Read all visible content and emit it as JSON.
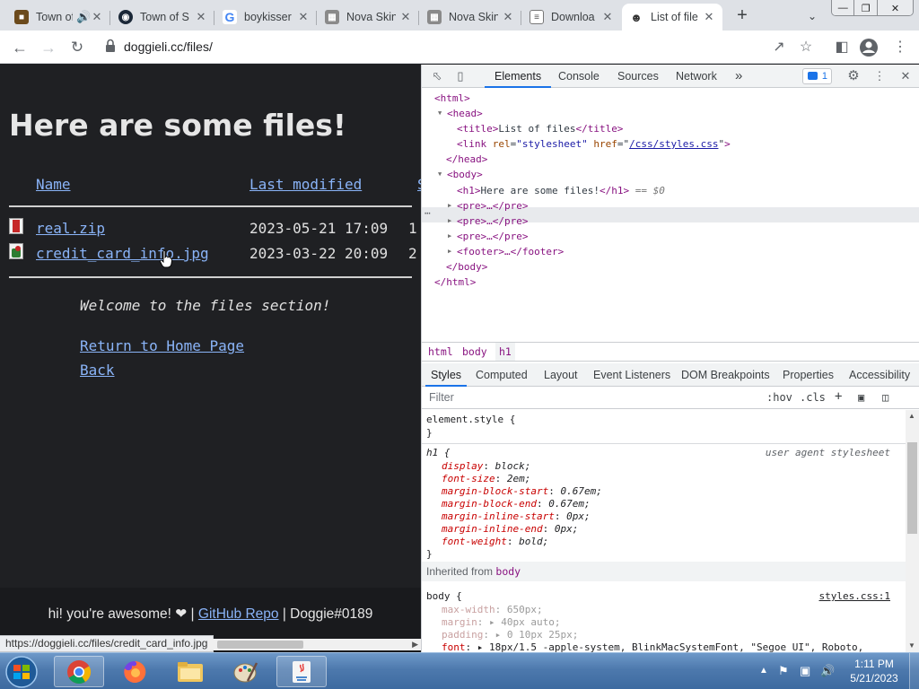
{
  "browser": {
    "tabs": [
      {
        "title": "Town of",
        "favicon": "game-icon"
      },
      {
        "title": "Town of S",
        "favicon": "steam-icon"
      },
      {
        "title": "boykisser",
        "favicon": "google-icon"
      },
      {
        "title": "Nova Skin",
        "favicon": "minecraft-icon"
      },
      {
        "title": "Nova Skin",
        "favicon": "minecraft-icon"
      },
      {
        "title": "Downloa",
        "favicon": "document-icon"
      },
      {
        "title": "List of file",
        "favicon": "dog-icon"
      }
    ],
    "url": "doggieli.cc/files/",
    "status_url": "https://doggieli.cc/files/credit_card_info.jpg"
  },
  "page": {
    "heading": "Here are some files!",
    "columns": {
      "name": "Name",
      "modified": "Last modified",
      "size": "S"
    },
    "files": [
      {
        "name": "real.zip",
        "modified": "2023-05-21 17:09",
        "size": "1"
      },
      {
        "name": "credit_card_info.jpg",
        "modified": "2023-03-22 20:09",
        "size": "2"
      }
    ],
    "welcome": "Welcome to the files section!",
    "links": {
      "home": "Return to Home Page",
      "back": "Back"
    },
    "footer": {
      "prefix": "hi! you're awesome! ❤ |",
      "repo": "GitHub Repo",
      "suffix": "| Doggie#0189"
    }
  },
  "devtools": {
    "tabs": [
      "Elements",
      "Console",
      "Sources",
      "Network",
      "»"
    ],
    "issues_count": "1",
    "dom": {
      "html_open": "<html>",
      "head_open": "<head>",
      "title_open": "<title>",
      "title_text": "List of files",
      "title_close": "</title>",
      "link_open": "<link ",
      "link_rel_attr": "rel",
      "link_rel_val": "\"stylesheet\"",
      "link_href_attr": " href",
      "link_href_val": "/css/styles.css",
      "link_close": ">",
      "head_close": "</head>",
      "body_open": "<body>",
      "h1_open": "<h1>",
      "h1_text": "Here are some files!",
      "h1_close": "</h1>",
      "h1_eq": "== $0",
      "pre1": "<pre>…</pre>",
      "pre2": "<pre>…</pre>",
      "pre3": "<pre>…</pre>",
      "footer": "<footer>…</footer>",
      "body_close": "</body>",
      "html_close": "</html>"
    },
    "breadcrumbs": [
      "html",
      "body",
      "h1"
    ],
    "style_tabs": [
      "Styles",
      "Computed",
      "Layout",
      "Event Listeners",
      "DOM Breakpoints",
      "Properties",
      "Accessibility"
    ],
    "filter_placeholder": "Filter",
    "filter_hov": ":hov",
    "filter_cls": ".cls",
    "element_style": "element.style {",
    "close_brace": "}",
    "h1_rule": {
      "selector": "h1 {",
      "source": "user agent stylesheet",
      "props": [
        {
          "p": "display",
          "v": "block;"
        },
        {
          "p": "font-size",
          "v": "2em;"
        },
        {
          "p": "margin-block-start",
          "v": "0.67em;"
        },
        {
          "p": "margin-block-end",
          "v": "0.67em;"
        },
        {
          "p": "margin-inline-start",
          "v": "0px;"
        },
        {
          "p": "margin-inline-end",
          "v": "0px;"
        },
        {
          "p": "font-weight",
          "v": "bold;"
        }
      ]
    },
    "inherited_label": "Inherited from",
    "inherited_from": "body",
    "body_rule": {
      "selector": "body {",
      "source": "styles.css:1",
      "props": [
        {
          "p": "max-width",
          "v": "650px;"
        },
        {
          "p": "margin",
          "v": "40px auto;"
        },
        {
          "p": "padding",
          "v": "0 10px 25px;"
        },
        {
          "p": "font",
          "v": "18px/1.5 -apple-system, BlinkMacSystemFont, \"Segoe UI\", Roboto,"
        }
      ]
    }
  },
  "taskbar": {
    "time": "1:11 PM",
    "date": "5/21/2023",
    "apps": [
      "chrome-icon",
      "firefox-icon",
      "explorer-icon",
      "paint-icon",
      "java-icon"
    ]
  },
  "colors": {
    "link": "#8ab4f8",
    "page_bg": "#1f2023",
    "accent": "#1a73e8"
  }
}
